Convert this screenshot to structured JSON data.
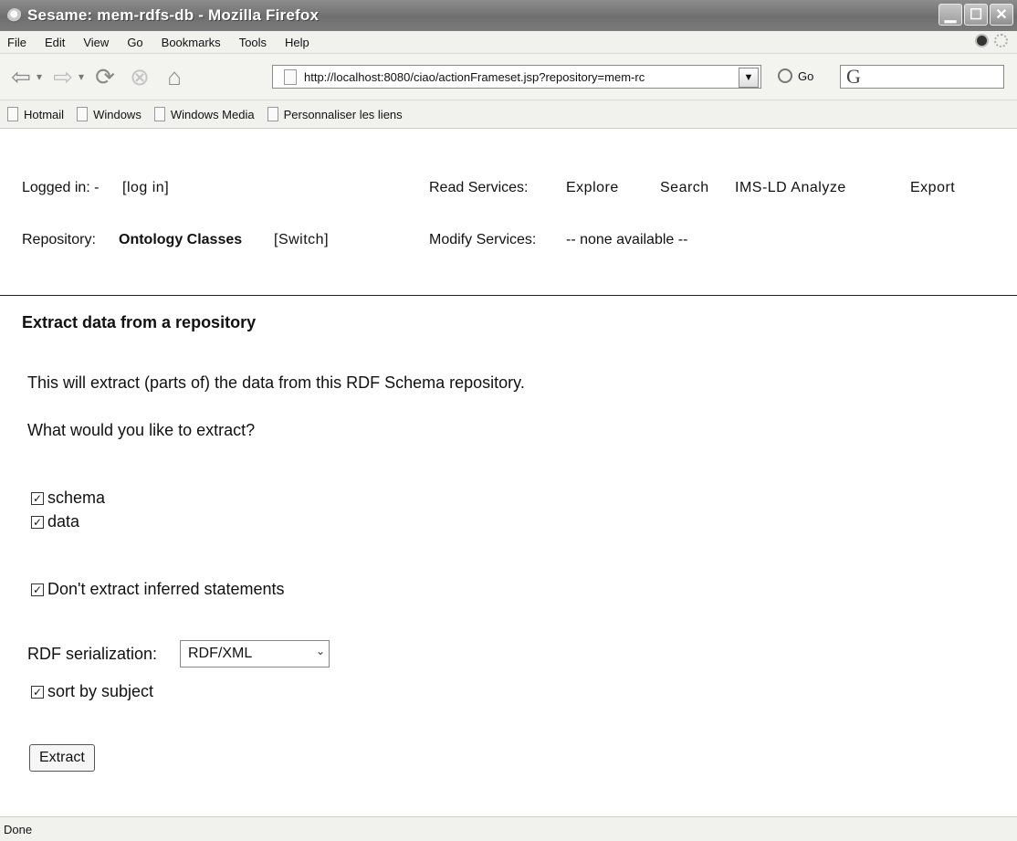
{
  "window": {
    "title": "Sesame: mem-rdfs-db - Mozilla Firefox"
  },
  "menu": [
    "File",
    "Edit",
    "View",
    "Go",
    "Bookmarks",
    "Tools",
    "Help"
  ],
  "toolbar": {
    "url": "http://localhost:8080/ciao/actionFrameset.jsp?repository=mem-rc",
    "go_label": "Go",
    "search_glyph": "G"
  },
  "bookmarks": [
    "Hotmail",
    "Windows",
    "Windows Media",
    "Personnaliser les liens"
  ],
  "header": {
    "logged_in_label": "Logged in: -",
    "login_link": "[log in]",
    "read_services_label": "Read Services:",
    "read_links": [
      "Explore",
      "Search",
      "IMS-LD Analyze",
      "Export"
    ],
    "repository_label": "Repository:",
    "repository_name": "Ontology Classes",
    "switch_link": "[Switch]",
    "modify_services_label": "Modify Services:",
    "modify_services_value": "-- none available --"
  },
  "main": {
    "title": "Extract data from a repository",
    "intro": "This will extract (parts of) the data from this RDF Schema repository.",
    "question": "What would you like to extract?",
    "options": [
      {
        "label": "schema",
        "checked": true
      },
      {
        "label": "data",
        "checked": true
      }
    ],
    "inferred": {
      "label": "Don't extract inferred statements",
      "checked": true
    },
    "serialization_label": "RDF serialization:",
    "serialization_value": "RDF/XML",
    "sort": {
      "label": "sort by subject",
      "checked": true
    },
    "extract_button": "Extract"
  },
  "status": {
    "text": "Done"
  }
}
